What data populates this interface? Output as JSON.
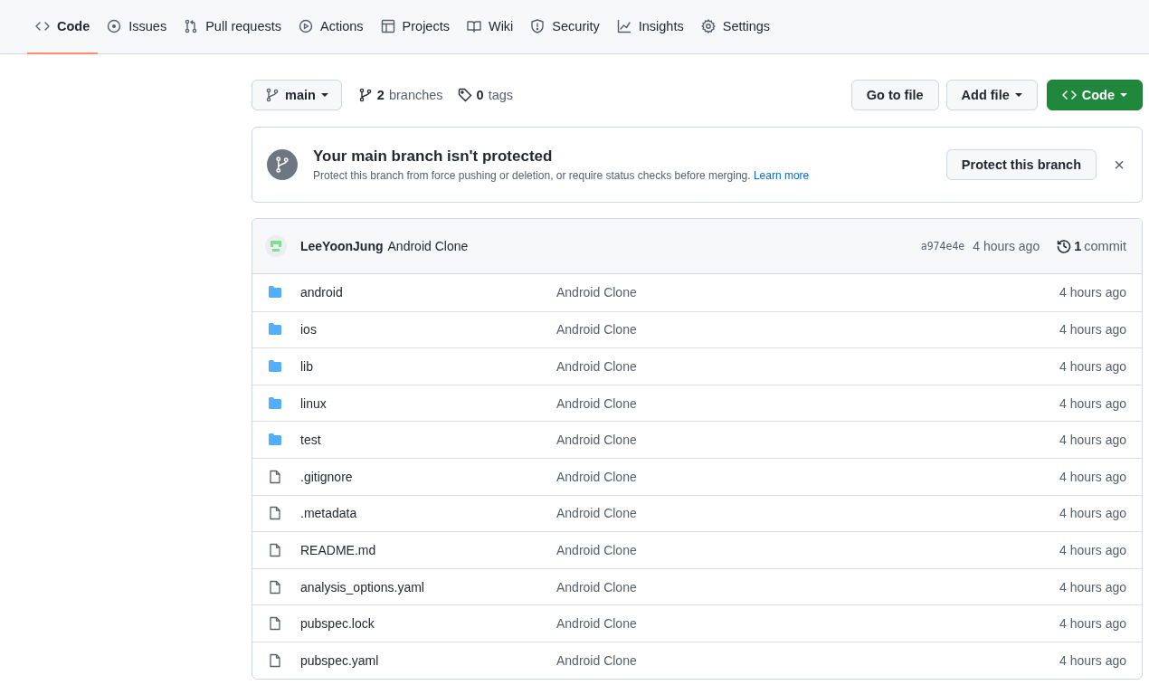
{
  "tabs": [
    {
      "label": "Code",
      "kind": "code",
      "selected": true
    },
    {
      "label": "Issues",
      "kind": "issue",
      "selected": false
    },
    {
      "label": "Pull requests",
      "kind": "pr",
      "selected": false
    },
    {
      "label": "Actions",
      "kind": "play",
      "selected": false
    },
    {
      "label": "Projects",
      "kind": "table",
      "selected": false
    },
    {
      "label": "Wiki",
      "kind": "book",
      "selected": false
    },
    {
      "label": "Security",
      "kind": "shield",
      "selected": false
    },
    {
      "label": "Insights",
      "kind": "graph",
      "selected": false
    },
    {
      "label": "Settings",
      "kind": "gear",
      "selected": false
    }
  ],
  "branch_button": {
    "label": "main"
  },
  "branches": {
    "count": "2",
    "label": "branches"
  },
  "tags": {
    "count": "0",
    "label": "tags"
  },
  "go_to_file": "Go to file",
  "add_file": "Add file",
  "code_button": "Code",
  "banner": {
    "title": "Your main branch isn't protected",
    "text": "Protect this branch from force pushing or deletion, or require status checks before merging.",
    "link": "Learn more",
    "button": "Protect this branch",
    "close": "×"
  },
  "commit": {
    "author": "LeeYoonJung",
    "message": "Android Clone",
    "hash": "a974e4e",
    "time": "4 hours ago",
    "count": "1",
    "count_label": "commit"
  },
  "files": [
    {
      "kind": "folder",
      "name": "android",
      "message": "Android Clone",
      "time": "4 hours ago"
    },
    {
      "kind": "folder",
      "name": "ios",
      "message": "Android Clone",
      "time": "4 hours ago"
    },
    {
      "kind": "folder",
      "name": "lib",
      "message": "Android Clone",
      "time": "4 hours ago"
    },
    {
      "kind": "folder",
      "name": "linux",
      "message": "Android Clone",
      "time": "4 hours ago"
    },
    {
      "kind": "folder",
      "name": "test",
      "message": "Android Clone",
      "time": "4 hours ago"
    },
    {
      "kind": "file",
      "name": ".gitignore",
      "message": "Android Clone",
      "time": "4 hours ago"
    },
    {
      "kind": "file",
      "name": ".metadata",
      "message": "Android Clone",
      "time": "4 hours ago"
    },
    {
      "kind": "file",
      "name": "README.md",
      "message": "Android Clone",
      "time": "4 hours ago"
    },
    {
      "kind": "file",
      "name": "analysis_options.yaml",
      "message": "Android Clone",
      "time": "4 hours ago"
    },
    {
      "kind": "file",
      "name": "pubspec.lock",
      "message": "Android Clone",
      "time": "4 hours ago"
    },
    {
      "kind": "file",
      "name": "pubspec.yaml",
      "message": "Android Clone",
      "time": "4 hours ago"
    }
  ]
}
